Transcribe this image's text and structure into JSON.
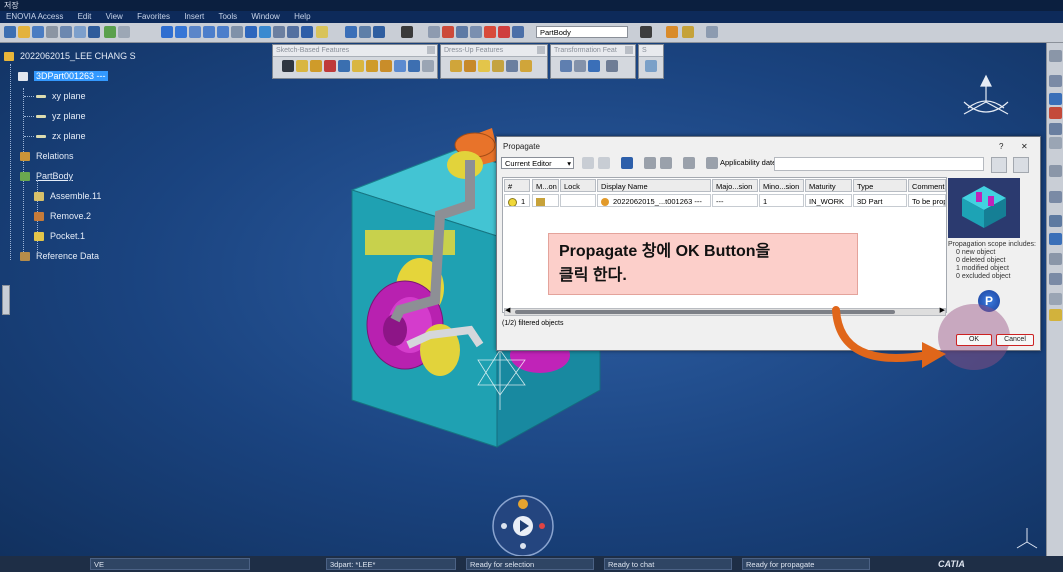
{
  "window": {
    "title": "저장"
  },
  "menu": [
    "ENOVIA Access",
    "Edit",
    "View",
    "Favorites",
    "Insert",
    "Tools",
    "Window",
    "Help"
  ],
  "toolbar": {
    "workbench_select": "PartBody"
  },
  "tree": {
    "root": "2022062015_LEE CHANG S",
    "part": "3DPart001263 ---",
    "items": [
      "xy plane",
      "yz plane",
      "zx plane",
      "Relations",
      "PartBody",
      "Assemble.11",
      "Remove.2",
      "Pocket.1",
      "Reference Data"
    ]
  },
  "panels": [
    "Sketch-Based Features",
    "Dress-Up Features",
    "Transformation Feat",
    "S"
  ],
  "dialog": {
    "title": "Propagate",
    "help_label": "?",
    "close_label": "✕",
    "filter": "Current Editor",
    "applicability_label": "Applicability date:",
    "columns": [
      "#",
      "M...on",
      "Lock",
      "Display Name",
      "Majo...sion",
      "Mino...sion",
      "Maturity",
      "Type",
      "Comment"
    ],
    "row": {
      "index": "1",
      "display_name": "2022062015_...t001263 ---",
      "major": "---",
      "minor": "1",
      "maturity": "IN_WORK",
      "type": "3D Part",
      "comment": "To be propa"
    },
    "filtered_text": "(1/2)  filtered objects",
    "scope_title": "Propagation scope includes:",
    "scope": [
      "0  new object",
      "0  deleted object",
      "1  modified object",
      "0  excluded object"
    ],
    "ok_label": "OK",
    "cancel_label": "Cancel"
  },
  "annotation": {
    "line1": "Propagate 창에 OK Button을",
    "line2": "클릭 한다."
  },
  "taskbar": {
    "item1": "3dpart: *LEE*",
    "item2": "Ready for selection",
    "item3": "Ready to chat",
    "item4": "Ready for propagate",
    "brand": "CATIA",
    "start_label": "VE"
  },
  "colors": {
    "viewport": "#1a437f",
    "cube": "#23a7b8",
    "holes": "#c023b8",
    "accent_arrow": "#e0661a",
    "note_bg": "#fccfca"
  }
}
